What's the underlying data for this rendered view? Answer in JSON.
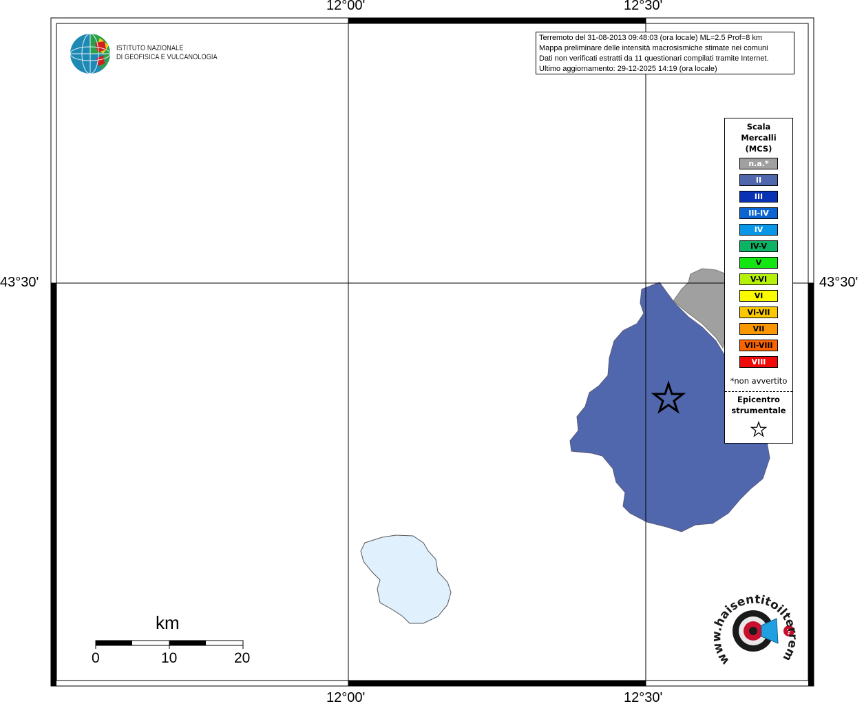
{
  "coordinates": {
    "top_left_lon": "12°00'",
    "top_right_lon": "12°30'",
    "bottom_left_lon": "12°00'",
    "bottom_right_lon": "12°30'",
    "left_lat": "43°30'",
    "right_lat": "43°30'"
  },
  "institute": {
    "line1": "ISTITUTO NAZIONALE",
    "line2": "DI GEOFISICA E VULCANOLOGIA"
  },
  "info": {
    "line1": "Terremoto del 31-08-2013 09:48:03 (ora locale) ML=2.5 Prof=8 km",
    "line2": "Mappa preliminare delle intensità macrosismiche stimate nei comuni",
    "line3": "Dati non verificati estratti da 11 questionari compilati tramite Internet.",
    "line4": "Ultimo aggiornamento: 29-12-2025 14:19 (ora locale)"
  },
  "legend": {
    "title_line1": "Scala",
    "title_line2": "Mercalli",
    "title_line3": "(MCS)",
    "classes": [
      {
        "label": "n.a.*",
        "color": "#a0a0a0"
      },
      {
        "label": "II",
        "color": "#5067ad"
      },
      {
        "label": "III",
        "color": "#0a32b4"
      },
      {
        "label": "III-IV",
        "color": "#0a64d2"
      },
      {
        "label": "IV",
        "color": "#0a96e6"
      },
      {
        "label": "IV-V",
        "color": "#0ab464"
      },
      {
        "label": "V",
        "color": "#14e614"
      },
      {
        "label": "V-VI",
        "color": "#b4f00a"
      },
      {
        "label": "VI",
        "color": "#fafa00"
      },
      {
        "label": "VI-VII",
        "color": "#fac800"
      },
      {
        "label": "VII",
        "color": "#fa9600"
      },
      {
        "label": "VII-VIII",
        "color": "#fa6400"
      },
      {
        "label": "VIII",
        "color": "#f00a0a"
      }
    ],
    "note": "*non avvertito",
    "epicenter_line1": "Epicentro",
    "epicenter_line2": "strumentale"
  },
  "map_areas": {
    "main_area_intensity": "II",
    "main_area_color": "#5067ad",
    "not_felt_area_color": "#a0a0a0",
    "lake_color": "#e0f0fc"
  },
  "scale_bar": {
    "unit": "km",
    "labels": [
      "0",
      "10",
      "20"
    ]
  },
  "watermark_logo": {
    "text": "www.haisentitoilterremoto.it",
    "icon": "earthquake-target-icon"
  }
}
